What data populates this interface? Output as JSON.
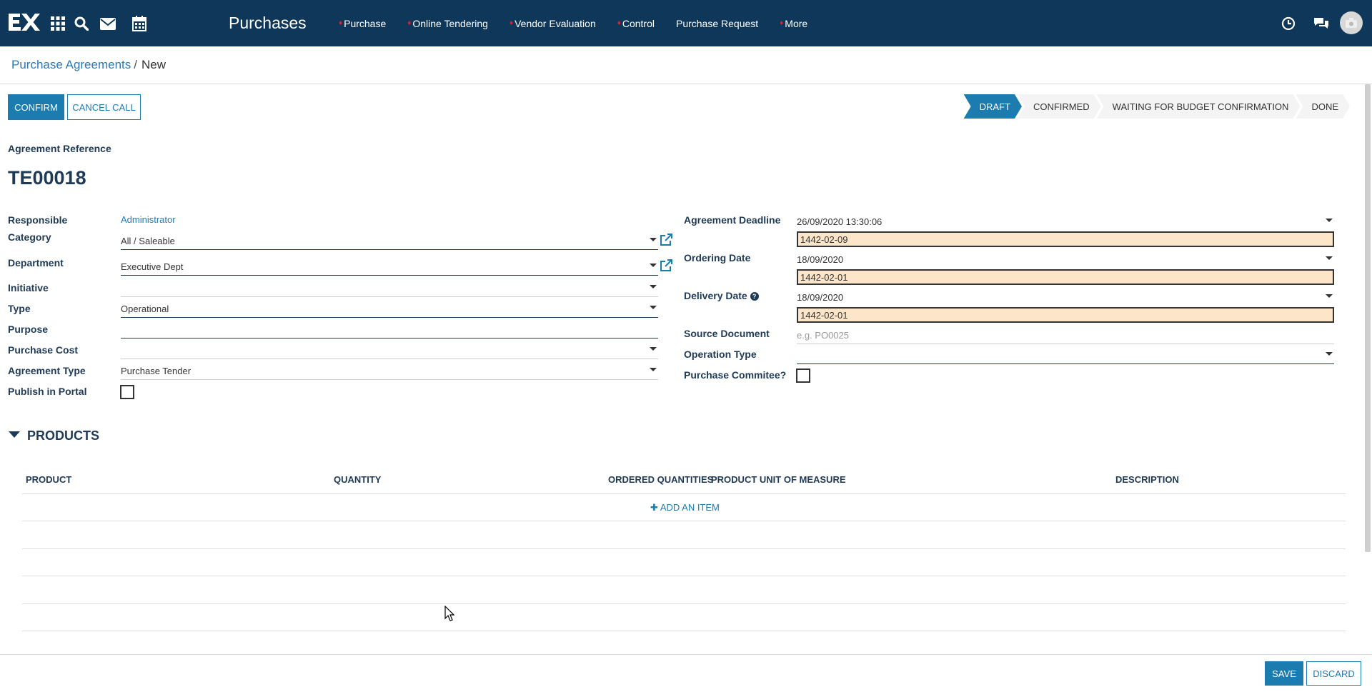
{
  "app": {
    "title": "Purchases"
  },
  "menu": [
    {
      "label": "Purchase",
      "dot": true
    },
    {
      "label": "Online Tendering",
      "dot": true
    },
    {
      "label": "Vendor Evaluation",
      "dot": true
    },
    {
      "label": "Control",
      "dot": true
    },
    {
      "label": "Purchase Request",
      "dot": false
    },
    {
      "label": "More",
      "dot": true
    }
  ],
  "breadcrumb": {
    "parent": "Purchase Agreements",
    "separator": "/",
    "current": "New"
  },
  "actions": {
    "confirm": "CONFIRM",
    "cancel_call": "CANCEL CALL"
  },
  "status": [
    {
      "label": "DRAFT",
      "active": true
    },
    {
      "label": "CONFIRMED",
      "active": false
    },
    {
      "label": "WAITING FOR BUDGET CONFIRMATION",
      "active": false
    },
    {
      "label": "DONE",
      "active": false
    }
  ],
  "form": {
    "ref_label": "Agreement Reference",
    "ref_value": "TE00018",
    "left": {
      "responsible_label": "Responsible",
      "responsible_value": "Administrator",
      "category_label": "Category",
      "category_value": "All / Saleable",
      "department_label": "Department",
      "department_value": "Executive Dept",
      "initiative_label": "Initiative",
      "initiative_value": "",
      "type_label": "Type",
      "type_value": "Operational",
      "purpose_label": "Purpose",
      "purpose_value": "",
      "purchase_cost_label": "Purchase Cost",
      "purchase_cost_value": "",
      "agreement_type_label": "Agreement Type",
      "agreement_type_value": "Purchase Tender",
      "publish_label": "Publish in Portal"
    },
    "right": {
      "deadline_label": "Agreement Deadline",
      "deadline_value": "26/09/2020 13:30:06",
      "deadline_hijri": "1442-02-09",
      "ordering_label": "Ordering Date",
      "ordering_value": "18/09/2020",
      "ordering_hijri": "1442-02-01",
      "delivery_label": "Delivery Date",
      "delivery_value": "18/09/2020",
      "delivery_hijri": "1442-02-01",
      "source_label": "Source Document",
      "source_placeholder": "e.g. PO0025",
      "operation_label": "Operation Type",
      "operation_value": "",
      "committee_label": "Purchase Commitee?"
    }
  },
  "products": {
    "title": "PRODUCTS",
    "columns": [
      "PRODUCT",
      "QUANTITY",
      "ORDERED QUANTITIES",
      "PRODUCT UNIT OF MEASURE",
      "DESCRIPTION"
    ],
    "add_item": "ADD AN ITEM"
  },
  "footer": {
    "save": "SAVE",
    "discard": "DISCARD"
  },
  "colors": {
    "topbar": "#0e3759",
    "accent": "#1c7cb0",
    "hijri_bg": "#fde5c9"
  }
}
